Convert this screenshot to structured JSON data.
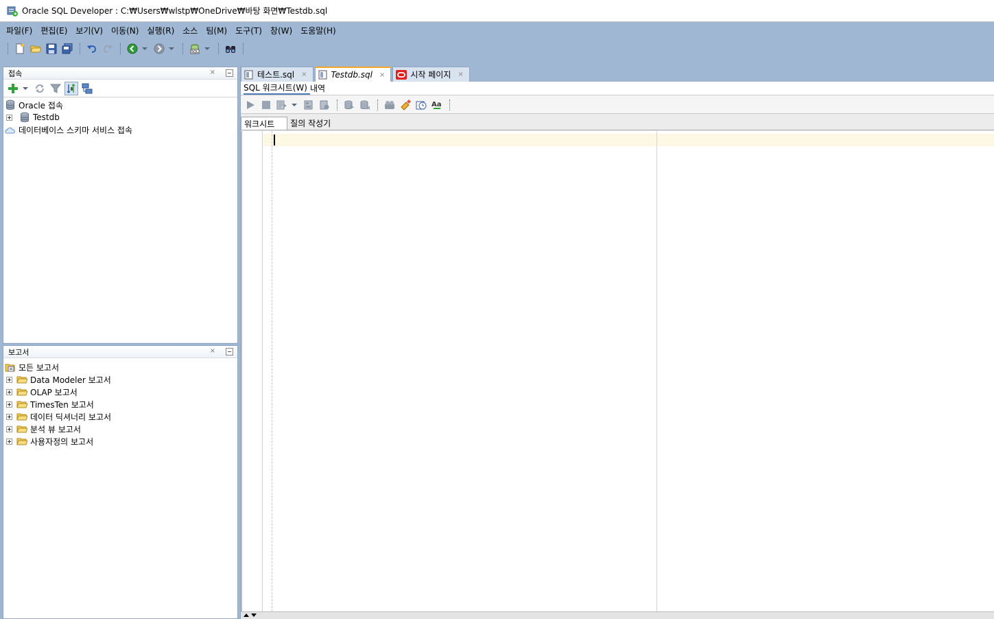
{
  "window": {
    "title": "Oracle SQL Developer : C:₩Users₩wlstp₩OneDrive₩바탕 화면₩Testdb.sql"
  },
  "menu": [
    {
      "label": "파일(F)"
    },
    {
      "label": "편집(E)"
    },
    {
      "label": "보기(V)"
    },
    {
      "label": "이동(N)"
    },
    {
      "label": "실행(R)"
    },
    {
      "label": "소스"
    },
    {
      "label": "팀(M)"
    },
    {
      "label": "도구(T)"
    },
    {
      "label": "창(W)"
    },
    {
      "label": "도움말(H)"
    }
  ],
  "connections_panel": {
    "title": "접속",
    "close": "×",
    "tree": [
      {
        "label": "Oracle 접속",
        "icon": "database-icon"
      },
      {
        "label": "Testdb",
        "icon": "database-icon"
      },
      {
        "label": "데이터베이스 스키마 서비스 접속",
        "icon": "cloud-icon"
      }
    ]
  },
  "reports_panel": {
    "title": "보고서",
    "close": "×",
    "tree": [
      {
        "label": "모든 보고서",
        "icon": "reports-icon"
      },
      {
        "label": "Data Modeler 보고서",
        "icon": "folder-icon"
      },
      {
        "label": "OLAP 보고서",
        "icon": "folder-icon"
      },
      {
        "label": "TimesTen 보고서",
        "icon": "folder-icon"
      },
      {
        "label": "데이터 딕셔너리 보고서",
        "icon": "folder-icon"
      },
      {
        "label": "분석 뷰 보고서",
        "icon": "folder-icon"
      },
      {
        "label": "사용자정의 보고서",
        "icon": "folder-icon"
      }
    ]
  },
  "editor": {
    "tabs": [
      {
        "label": "테스트.sql",
        "close": "×"
      },
      {
        "label": "Testdb.sql",
        "close": "×"
      },
      {
        "label": "시작 페이지",
        "close": "×"
      }
    ],
    "sub_tabs": [
      {
        "label": "SQL 워크시트(W)"
      },
      {
        "label": "내역"
      }
    ],
    "worksheet_tabs": [
      {
        "label": "워크시트"
      },
      {
        "label": "질의 작성기"
      }
    ]
  },
  "colors": {
    "chrome_blue": "#9fb7d3",
    "current_line": "#fdf8e4",
    "active_tab_accent": "#f5a623",
    "oracle_red": "#e02020"
  }
}
